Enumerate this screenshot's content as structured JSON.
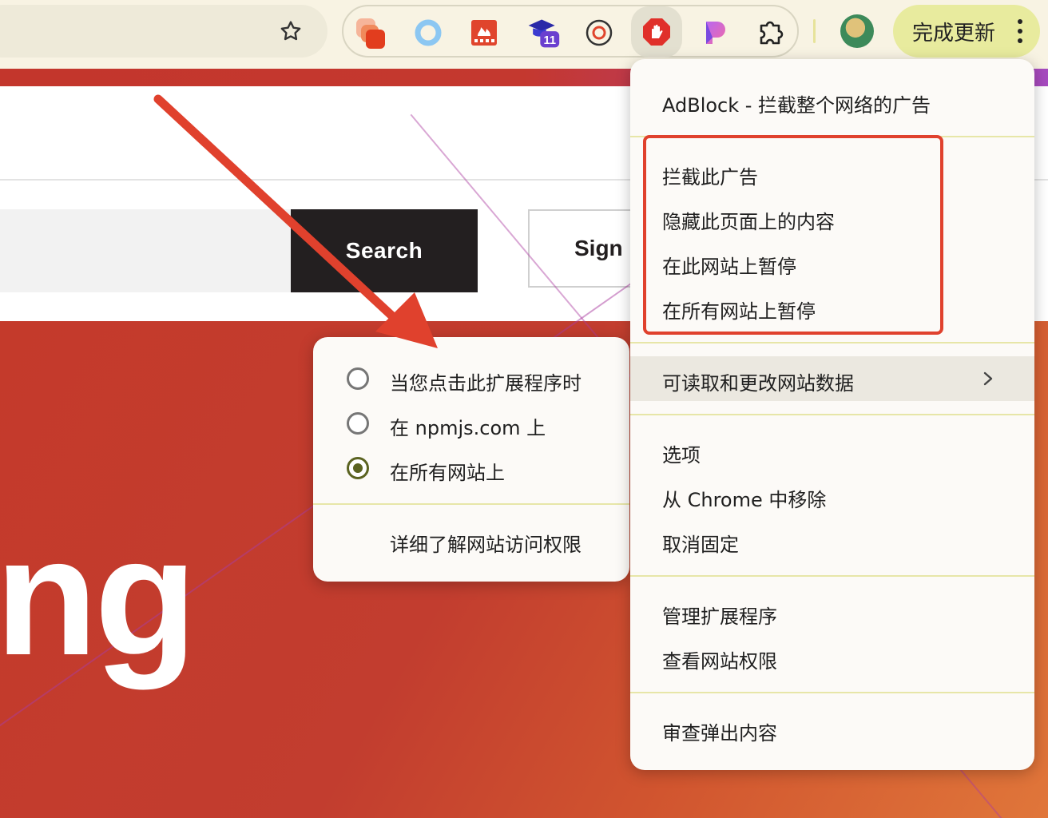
{
  "toolbar": {
    "update_label": "完成更新",
    "extensions": [
      {
        "icon": "app-stack-icon"
      },
      {
        "icon": "ring-icon"
      },
      {
        "icon": "fire-grid-icon"
      },
      {
        "icon": "grad-cap-icon",
        "badge": "11"
      },
      {
        "icon": "at-circle-icon"
      },
      {
        "icon": "adblock-hand-icon"
      },
      {
        "icon": "purple-p-icon"
      },
      {
        "icon": "puzzle-icon"
      }
    ]
  },
  "page": {
    "search_button": "Search",
    "sign_button": "Sign",
    "hero_text": "ng"
  },
  "menu": {
    "header": "AdBlock - 拦截整个网络的广告",
    "block_ad": "拦截此广告",
    "hide_content": "隐藏此页面上的内容",
    "pause_site": "在此网站上暂停",
    "pause_all": "在所有网站上暂停",
    "site_data": "可读取和更改网站数据",
    "options": "选项",
    "remove": "从 Chrome 中移除",
    "unpin": "取消固定",
    "manage": "管理扩展程序",
    "view_permissions": "查看网站权限",
    "inspect_popup": "审查弹出内容"
  },
  "submenu": {
    "on_click": "当您点击此扩展程序时",
    "on_site": "在 npmjs.com 上",
    "on_all": "在所有网站上",
    "selected": "在所有网站上",
    "learn_more": "详细了解网站访问权限"
  },
  "colors": {
    "annotation_red": "#e0412d",
    "accent_olive": "#5b6321",
    "update_bg": "#e8eb9e"
  }
}
